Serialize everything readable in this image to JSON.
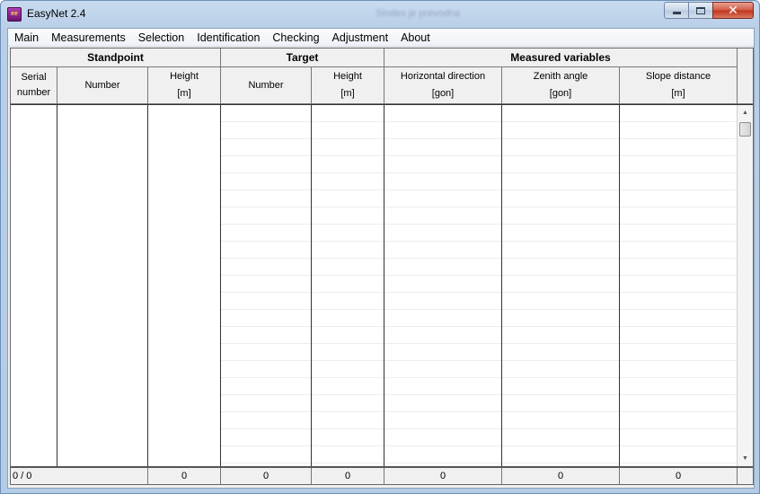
{
  "window": {
    "title": "EasyNet 2.4",
    "background_title": "Sindes je prevodna",
    "icon_text": "ee"
  },
  "menu": [
    "Main",
    "Measurements",
    "Selection",
    "Identification",
    "Checking",
    "Adjustment",
    "About"
  ],
  "table": {
    "groups": {
      "standpoint": "Standpoint",
      "target": "Target",
      "measured": "Measured variables"
    },
    "columns": {
      "serial_line1": "Serial",
      "serial_line2": "number",
      "sp_number": "Number",
      "sp_height": "Height",
      "sp_height_unit": "[m]",
      "tg_number": "Number",
      "tg_height": "Height",
      "tg_height_unit": "[m]",
      "hz": "Horizontal direction",
      "hz_unit": "[gon]",
      "zenith": "Zenith angle",
      "zenith_unit": "[gon]",
      "slope": "Slope distance",
      "slope_unit": "[m]"
    },
    "footer": {
      "record_count": "0 / 0",
      "sp_height_total": "0",
      "tg_number_total": "0",
      "tg_height_total": "0",
      "hz_total": "0",
      "zenith_total": "0",
      "slope_total": "0"
    }
  },
  "colors": {
    "title_bar": "#c9dbef",
    "close_button": "#c0331c",
    "app_icon": "#8a2290"
  }
}
